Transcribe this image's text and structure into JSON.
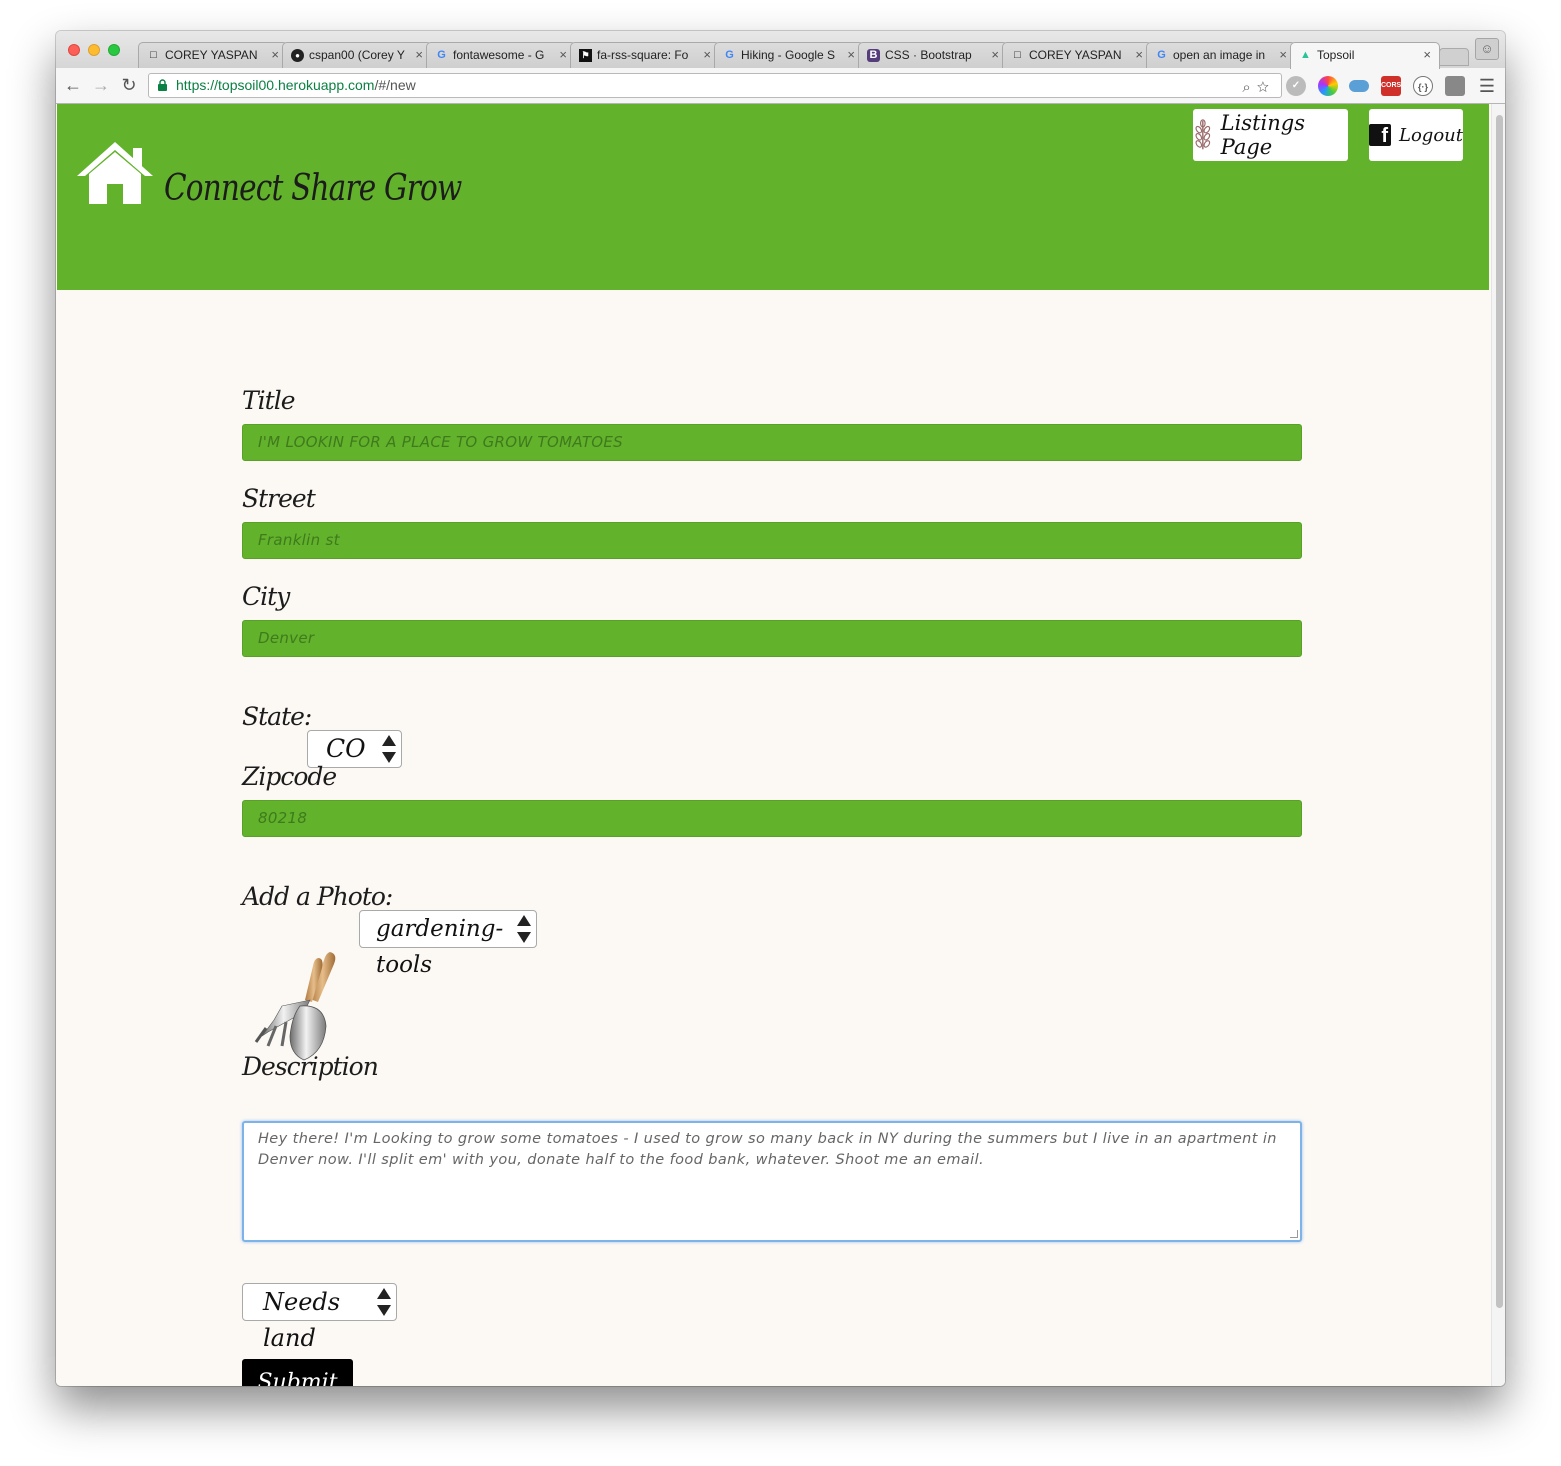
{
  "browser": {
    "tabs": [
      {
        "label": "COREY YASPAN",
        "icon": "page-icon"
      },
      {
        "label": "cspan00 (Corey Y",
        "icon": "github-icon"
      },
      {
        "label": "fontawesome - G",
        "icon": "google-icon"
      },
      {
        "label": "fa-rss-square: Fo",
        "icon": "flag-icon"
      },
      {
        "label": "Hiking - Google S",
        "icon": "google-icon"
      },
      {
        "label": "CSS · Bootstrap",
        "icon": "bootstrap-icon"
      },
      {
        "label": "COREY YASPAN",
        "icon": "page-icon"
      },
      {
        "label": "open an image in",
        "icon": "google-icon"
      },
      {
        "label": "Topsoil",
        "icon": "topsoil-icon"
      }
    ],
    "url_scheme": "https://",
    "url_host": "topsoil00.herokuapp.com",
    "url_path": "/#/new",
    "colors": {
      "https": "#0b8043"
    }
  },
  "header": {
    "brand": "Connect Share Grow",
    "listings_label": "Listings Page",
    "logout_label": "Logout",
    "color": "#62b22c"
  },
  "form": {
    "title_label": "Title",
    "title_placeholder": "I'M LOOKIN FOR A PLACE TO GROW TOMATOES",
    "street_label": "Street",
    "street_placeholder": "Franklin st",
    "city_label": "City",
    "city_placeholder": "Denver",
    "state_label": "State:",
    "state_value": "CO",
    "zipcode_label": "Zipcode",
    "zipcode_placeholder": "80218",
    "photo_label": "Add a Photo:",
    "photo_value": "gardening-tools",
    "description_label": "Description",
    "description_text": "Hey there! I'm Looking to grow some tomatoes - I used to grow so many back in NY during the summers but I live in an apartment in Denver now. I'll split em' with you, donate half to the food bank, whatever. Shoot me an email.",
    "need_value": "Needs land",
    "submit_label": "Submit"
  }
}
